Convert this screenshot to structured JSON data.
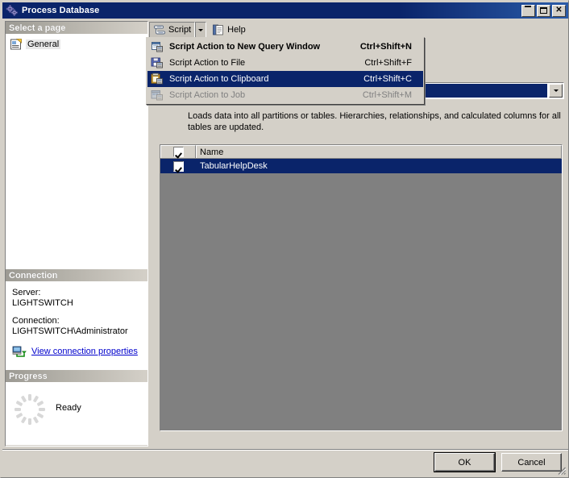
{
  "window": {
    "title": "Process Database",
    "icon": "gears-icon",
    "controls": {
      "minimize": "minimize-button",
      "maximize": "maximize-button",
      "close": "✕"
    }
  },
  "left_panel": {
    "select_page": {
      "header": "Select a page",
      "items": [
        {
          "label": "General",
          "icon": "page-icon",
          "selected": true
        }
      ]
    },
    "connection": {
      "header": "Connection",
      "server_label": "Server:",
      "server_value": "LIGHTSWITCH",
      "connection_label": "Connection:",
      "connection_value": "LIGHTSWITCH\\Administrator",
      "view_properties_link": "View connection properties",
      "view_properties_icon": "server-connection-icon"
    },
    "progress": {
      "header": "Progress",
      "status": "Ready",
      "icon": "spinner-icon"
    }
  },
  "right_panel": {
    "toolbar": {
      "script_button": "Script",
      "script_icon": "script-scroll-icon",
      "script_dropdown_icon": "chevron-down-icon",
      "help_button": "Help",
      "help_icon": "help-book-icon"
    },
    "combobox": {
      "value": "",
      "arrow_icon": "chevron-down-icon"
    },
    "description": "Loads data into all partitions or tables. Hierarchies, relationships, and calculated columns for all tables are updated.",
    "listview": {
      "columns": [
        "",
        "Name"
      ],
      "header_checkbox_checked": true,
      "rows": [
        {
          "checked": true,
          "name": "TabularHelpDesk",
          "selected": true
        }
      ]
    }
  },
  "menu": {
    "items": [
      {
        "label": "Script Action to New Query Window",
        "shortcut": "Ctrl+Shift+N",
        "icon": "new-query-window-icon",
        "bold": true,
        "highlighted": false,
        "disabled": false
      },
      {
        "label": "Script Action to File",
        "shortcut": "Ctrl+Shift+F",
        "icon": "save-to-file-icon",
        "bold": false,
        "highlighted": false,
        "disabled": false
      },
      {
        "label": "Script Action to Clipboard",
        "shortcut": "Ctrl+Shift+C",
        "icon": "clipboard-icon",
        "bold": false,
        "highlighted": true,
        "disabled": false
      },
      {
        "label": "Script Action to Job",
        "shortcut": "Ctrl+Shift+M",
        "icon": "job-icon",
        "bold": false,
        "highlighted": false,
        "disabled": true
      }
    ]
  },
  "footer": {
    "ok_button": "OK",
    "cancel_button": "Cancel",
    "resize_grip": "resize-grip"
  },
  "colors": {
    "dialog_face": "#d4d0c8",
    "titlebar": "#0a246a",
    "highlight": "#0a246a",
    "listview_background": "#808080",
    "link": "#0000cc",
    "disabled_text": "#808080"
  }
}
